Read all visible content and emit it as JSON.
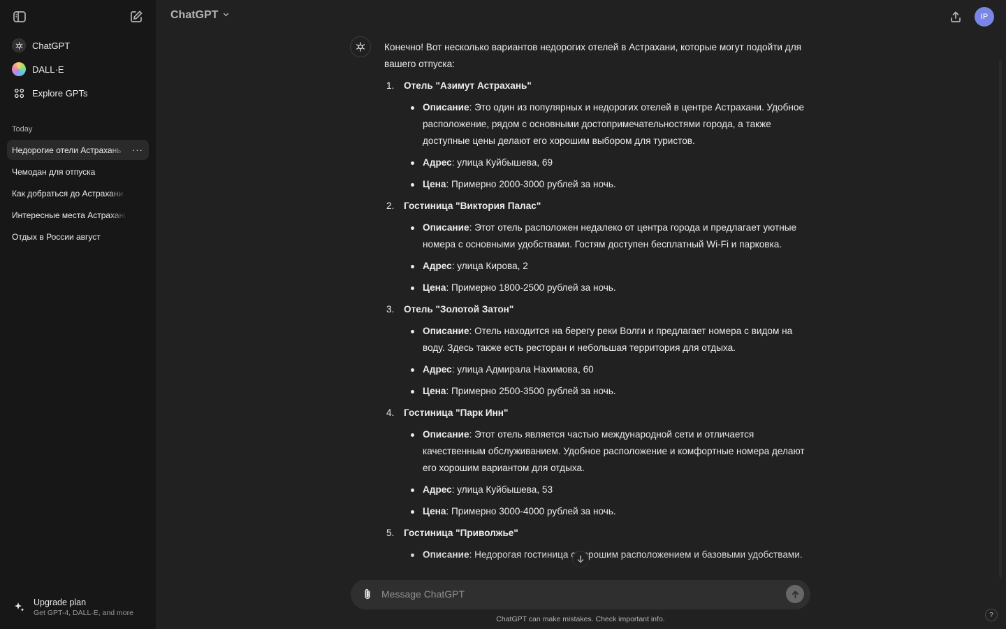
{
  "sidebar": {
    "nav": [
      {
        "label": "ChatGPT",
        "icon": "openai-logo-icon"
      },
      {
        "label": "DALL·E",
        "icon": "dalle-icon"
      },
      {
        "label": "Explore GPTs",
        "icon": "grid-icon"
      }
    ],
    "section_title": "Today",
    "history": [
      "Недорогие отели Астрахань",
      "Чемодан для отпуска",
      "Как добраться до Астрахани",
      "Интересные места Астрахани",
      "Отдых в России август"
    ],
    "history_more": "···",
    "upgrade": {
      "title": "Upgrade plan",
      "subtitle": "Get GPT-4, DALL·E, and more"
    }
  },
  "header": {
    "model": "ChatGPT",
    "avatar_initials": "IP"
  },
  "message": {
    "intro": "Конечно! Вот несколько вариантов недорогих отелей в Астрахани, которые могут подойти для вашего отпуска:",
    "label_desc": "Описание",
    "label_addr": "Адрес",
    "label_price": "Цена",
    "hotels": [
      {
        "num": "1.",
        "name": "Отель \"Азимут Астрахань\"",
        "desc": ": Это один из популярных и недорогих отелей в центре Астрахани. Удобное расположение, рядом с основными достопримечательностями города, а также доступные цены делают его хорошим выбором для туристов.",
        "addr": ": улица Куйбышева, 69",
        "price": ": Примерно 2000-3000 рублей за ночь."
      },
      {
        "num": "2.",
        "name": "Гостиница \"Виктория Палас\"",
        "desc": ": Этот отель расположен недалеко от центра города и предлагает уютные номера с основными удобствами. Гостям доступен бесплатный Wi-Fi и парковка.",
        "addr": ": улица Кирова, 2",
        "price": ": Примерно 1800-2500 рублей за ночь."
      },
      {
        "num": "3.",
        "name": "Отель \"Золотой Затон\"",
        "desc": ": Отель находится на берегу реки Волги и предлагает номера с видом на воду. Здесь также есть ресторан и небольшая территория для отдыха.",
        "addr": ": улица Адмирала Нахимова, 60",
        "price": ": Примерно 2500-3500 рублей за ночь."
      },
      {
        "num": "4.",
        "name": "Гостиница \"Парк Инн\"",
        "desc": ": Этот отель является частью международной сети и отличается качественным обслуживанием. Удобное расположение и комфортные номера делают его хорошим вариантом для отдыха.",
        "addr": ": улица Куйбышева, 53",
        "price": ": Примерно 3000-4000 рублей за ночь."
      },
      {
        "num": "5.",
        "name": "Гостиница \"Приволжье\"",
        "desc": ": Недорогая гостиница с хорошим расположением и базовыми удобствами."
      }
    ]
  },
  "composer": {
    "placeholder": "Message ChatGPT",
    "disclaimer": "ChatGPT can make mistakes. Check important info."
  },
  "help_label": "?"
}
